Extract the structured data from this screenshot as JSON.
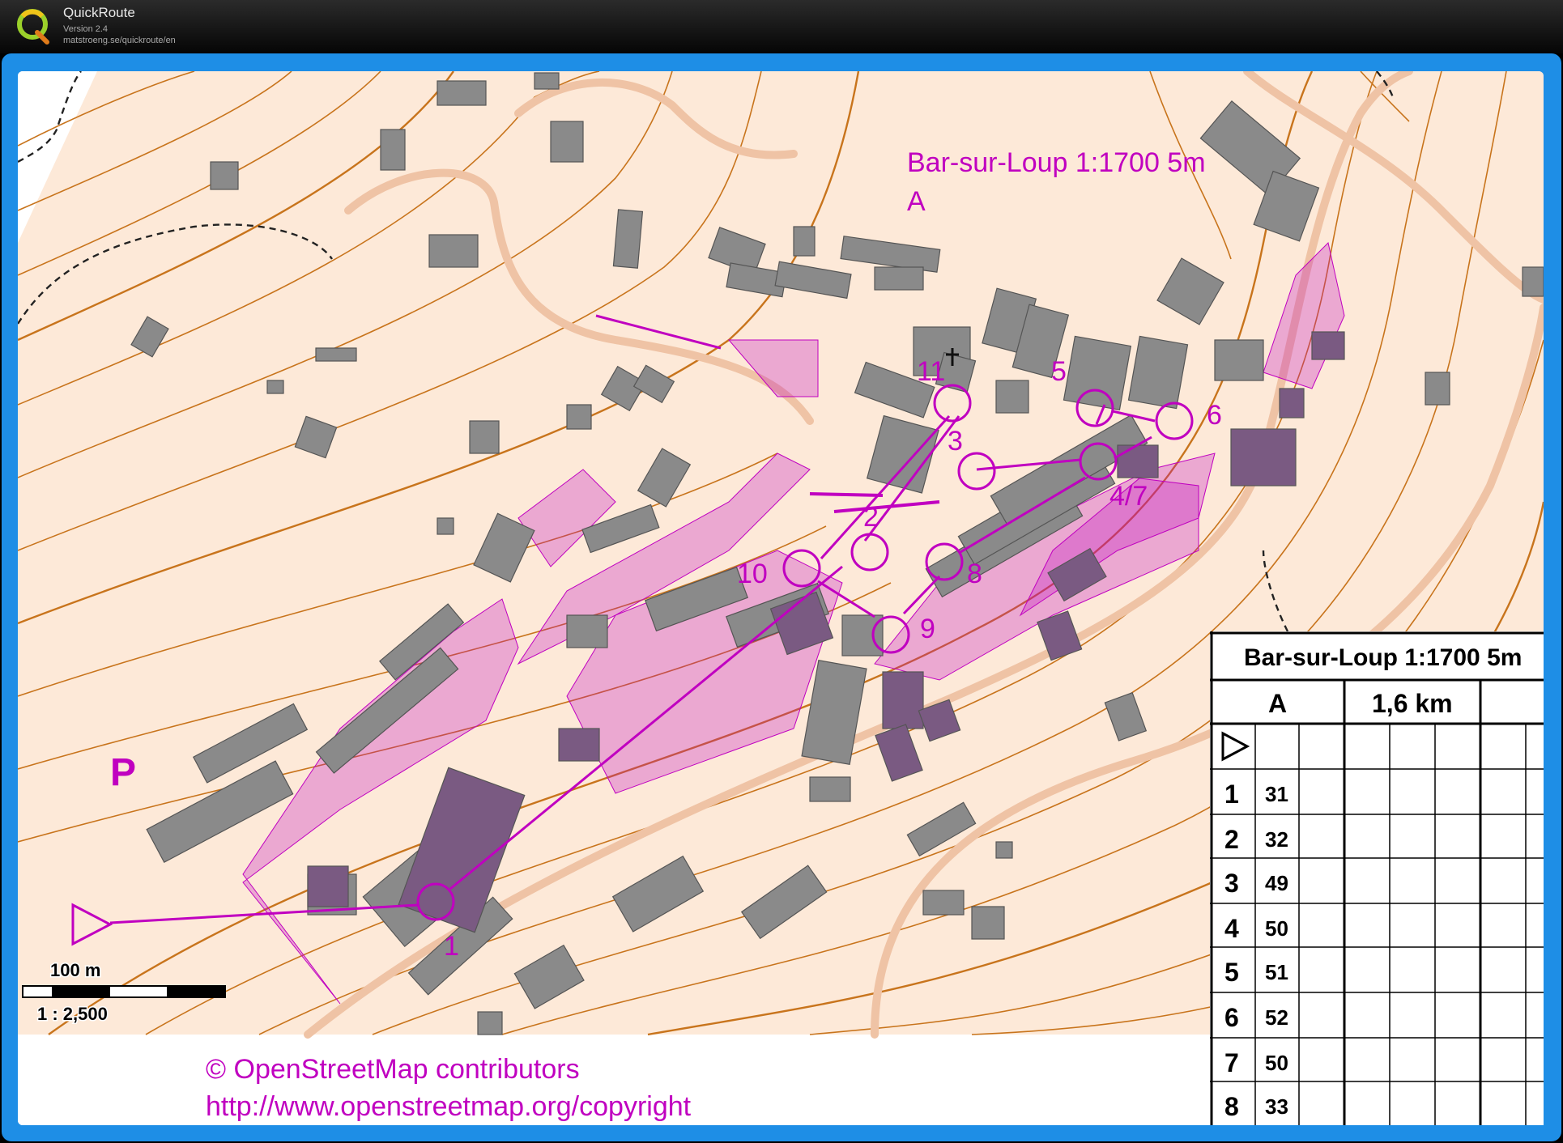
{
  "app": {
    "name": "QuickRoute",
    "version": "Version 2.4",
    "url": "matstroeng.se/quickroute/en"
  },
  "map": {
    "title": "Bar-sur-Loup 1:1700 5m",
    "course": "A",
    "parking_symbol": "P",
    "scale_bar_label": "100 m",
    "scale_ratio": "1 : 2,500",
    "copyright_line1": "© OpenStreetMap contributors",
    "copyright_line2": "http://www.openstreetmap.org/copyright",
    "controls": [
      {
        "label": "1"
      },
      {
        "label": "2"
      },
      {
        "label": "3"
      },
      {
        "label": "4"
      },
      {
        "label": "5"
      },
      {
        "label": "6"
      },
      {
        "label": "7"
      },
      {
        "label": "8"
      },
      {
        "label": "9"
      },
      {
        "label": "10"
      },
      {
        "label": "11"
      }
    ],
    "combined_label_4_7": "4/7",
    "colors": {
      "course_purple": "#c000c0",
      "contour_brown": "#c8741c",
      "terrain_bg": "#fde9d8",
      "building_gray": "#8a8a8a",
      "frame_blue": "#1e8ee6"
    }
  },
  "description_sheet": {
    "title": "Bar-sur-Loup 1:1700 5m",
    "course": "A",
    "length": "1,6 km",
    "start_symbol": "start-triangle",
    "rows": [
      {
        "num": "1",
        "code": "31"
      },
      {
        "num": "2",
        "code": "32"
      },
      {
        "num": "3",
        "code": "49"
      },
      {
        "num": "4",
        "code": "50"
      },
      {
        "num": "5",
        "code": "51"
      },
      {
        "num": "6",
        "code": "52"
      },
      {
        "num": "7",
        "code": "50"
      },
      {
        "num": "8",
        "code": "33"
      }
    ]
  }
}
